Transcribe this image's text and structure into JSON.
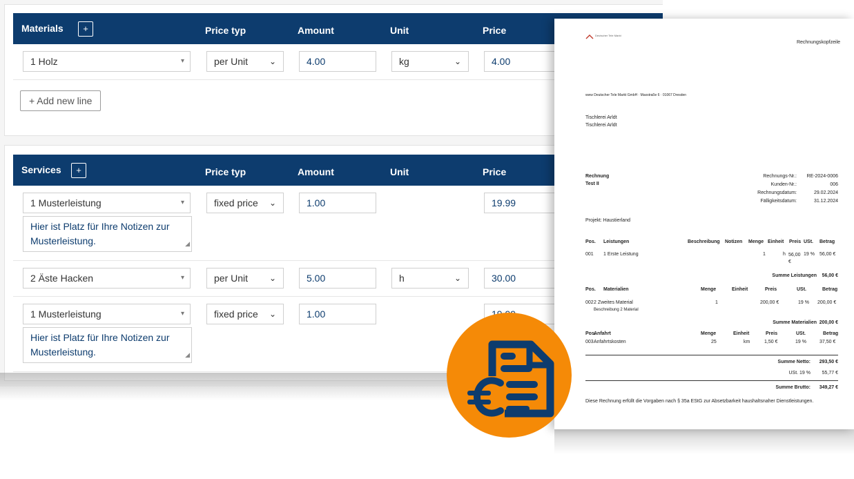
{
  "materials": {
    "title": "Materials",
    "add_icon": "+",
    "columns": [
      "Price typ",
      "Amount",
      "Unit",
      "Price"
    ],
    "rows": [
      {
        "name": "1 Holz",
        "price_type": "per Unit",
        "amount": "4.00",
        "unit": "kg",
        "price": "4.00"
      }
    ],
    "add_line_label": "+  Add new line"
  },
  "services": {
    "title": "Services",
    "add_icon": "+",
    "columns": [
      "Price typ",
      "Amount",
      "Unit",
      "Price"
    ],
    "rows": [
      {
        "name": "1 Musterleistung",
        "price_type": "fixed price",
        "amount": "1.00",
        "unit": "",
        "price": "19.99",
        "notes": "Hier ist Platz für Ihre Notizen zur Musterleistung."
      },
      {
        "name": "2 Äste Hacken",
        "price_type": "per Unit",
        "amount": "5.00",
        "unit": "h",
        "price": "30.00"
      },
      {
        "name": "1 Musterleistung",
        "price_type": "fixed price",
        "amount": "1.00",
        "unit": "",
        "price": "19.99",
        "notes": "Hier ist Platz für Ihre Notizen zur Musterleistung."
      }
    ]
  },
  "icons": {
    "select_caret": "▾",
    "dropdown_chevron": "⌄",
    "resize_grip": "◢"
  },
  "invoice": {
    "logo_text": "Deutscher Tele Markt",
    "header_right": "Rechnungskopfzeile",
    "sender_line": "www Deutscher Tele Markt GmbH · Maxstraße 6 · 01067 Dresden",
    "recipient": [
      "Tischlerei Arldt",
      "Tischlerei Arldt"
    ],
    "doc_title": "Rechnung",
    "doc_subtitle": "Test II",
    "meta": [
      {
        "label": "Rechnungs-Nr.:",
        "value": "RE-2024-0006"
      },
      {
        "label": "Kunden-Nr.:",
        "value": "006"
      },
      {
        "label": "Rechnungsdatum:",
        "value": "29.02.2024"
      },
      {
        "label": "Fälligkeitsdatum:",
        "value": "31.12.2024"
      }
    ],
    "project": "Projekt: Haustierland",
    "services_header": [
      "Pos.",
      "Leistungen",
      "Beschreibung",
      "Notizen",
      "Menge",
      "Einheit",
      "Preis",
      "USt.",
      "Betrag"
    ],
    "services_rows": [
      {
        "pos": "001",
        "name": "1 Erste Leistung",
        "qty": "1",
        "unit": "h",
        "price": "56,00 €",
        "vat": "19 %",
        "total": "56,00 €"
      }
    ],
    "services_sum": {
      "label": "Summe Leistungen",
      "value": "56,00 €"
    },
    "materials_header": [
      "Pos.",
      "Materialien",
      "Menge",
      "Einheit",
      "Preis",
      "USt.",
      "Betrag"
    ],
    "materials_rows": [
      {
        "pos": "002",
        "name": "2 Zweites Material",
        "desc": "Beschreibung 2 Material",
        "qty": "1",
        "unit": "",
        "price": "200,00 €",
        "vat": "19 %",
        "total": "200,00 €"
      }
    ],
    "materials_sum": {
      "label": "Summe Materialien",
      "value": "200,00 €"
    },
    "travel_header": [
      "Pos.",
      "Anfahrt",
      "Menge",
      "Einheit",
      "Preis",
      "USt.",
      "Betrag"
    ],
    "travel_rows": [
      {
        "pos": "003",
        "name": "Anfahrtskosten",
        "qty": "25",
        "unit": "km",
        "price": "1,50 €",
        "vat": "19 %",
        "total": "37,50 €"
      }
    ],
    "net": {
      "label": "Summe Netto:",
      "value": "293,50 €"
    },
    "vat": {
      "label": "USt. 19 %",
      "value": "55,77 €"
    },
    "gross": {
      "label": "Summe Brutto:",
      "value": "349,27 €"
    },
    "footer": "Diese Rechnung erfüllt die Vorgaben nach § 35a EStG zur Absetzbarkeit haushaltsnaher Dienstleistungen."
  },
  "badge": {
    "icon": "euro-invoice-icon",
    "color": "#f58a07",
    "icon_color": "#0d3c6e"
  },
  "colors": {
    "header": "#0d3c6e",
    "accent": "#f58a07"
  }
}
